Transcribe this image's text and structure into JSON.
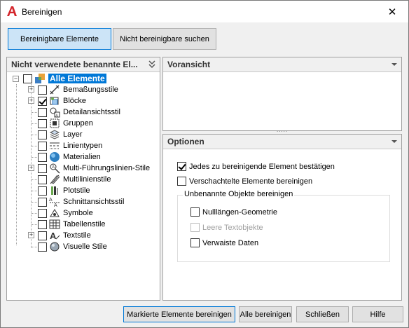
{
  "window": {
    "title": "Bereinigen",
    "close_glyph": "✕"
  },
  "tabs": [
    {
      "label": "Bereinigbare Elemente",
      "active": true
    },
    {
      "label": "Nicht bereinigbare suchen",
      "active": false
    }
  ],
  "left_panel": {
    "header": "Nicht verwendete benannte El...",
    "root": {
      "label": "Alle Elemente",
      "expander": "−"
    },
    "items": [
      {
        "label": "Bemaßungsstile",
        "checked": false,
        "expander": "+",
        "icon": "dimension-style-icon"
      },
      {
        "label": "Blöcke",
        "checked": true,
        "expander": "+",
        "icon": "block-icon"
      },
      {
        "label": "Detailansichtsstil",
        "checked": false,
        "expander": "",
        "icon": "detail-view-icon"
      },
      {
        "label": "Gruppen",
        "checked": false,
        "expander": "",
        "icon": "group-icon"
      },
      {
        "label": "Layer",
        "checked": false,
        "expander": "",
        "icon": "layer-icon"
      },
      {
        "label": "Linientypen",
        "checked": false,
        "expander": "",
        "icon": "linetype-icon"
      },
      {
        "label": "Materialien",
        "checked": false,
        "expander": "",
        "icon": "material-sphere-icon"
      },
      {
        "label": "Multi-Führungslinien-Stile",
        "checked": false,
        "expander": "+",
        "icon": "multileader-style-icon"
      },
      {
        "label": "Multilinienstile",
        "checked": false,
        "expander": "",
        "icon": "multiline-style-icon"
      },
      {
        "label": "Plotstile",
        "checked": false,
        "expander": "",
        "icon": "plot-style-icon"
      },
      {
        "label": "Schnittansichtsstil",
        "checked": false,
        "expander": "",
        "icon": "section-view-icon"
      },
      {
        "label": "Symbole",
        "checked": false,
        "expander": "",
        "icon": "symbol-icon"
      },
      {
        "label": "Tabellenstile",
        "checked": false,
        "expander": "",
        "icon": "table-style-icon"
      },
      {
        "label": "Textstile",
        "checked": false,
        "expander": "+",
        "icon": "text-style-icon"
      },
      {
        "label": "Visuelle Stile",
        "checked": false,
        "expander": "",
        "icon": "visual-style-icon"
      }
    ]
  },
  "preview_panel": {
    "header": "Voransicht",
    "splitter": "....."
  },
  "options_panel": {
    "header": "Optionen",
    "confirm_each": {
      "label": "Jedes zu bereinigende Element bestätigen",
      "checked": true
    },
    "nested": {
      "label": "Verschachtelte Elemente bereinigen",
      "checked": false
    },
    "unnamed_group": {
      "title": "Unbenannte Objekte bereinigen",
      "zero_length": {
        "label": "Nulllängen-Geometrie",
        "checked": false,
        "disabled": false
      },
      "empty_text": {
        "label": "Leere Textobjekte",
        "checked": false,
        "disabled": true
      },
      "orphaned": {
        "label": "Verwaiste Daten",
        "checked": false,
        "disabled": false
      }
    }
  },
  "buttons": {
    "purge_checked": "Markierte Elemente bereinigen",
    "purge_all": "Alle bereinigen",
    "close": "Schließen",
    "help": "Hilfe"
  },
  "colors": {
    "accent": "#0078d7",
    "app_red": "#d4262c"
  }
}
